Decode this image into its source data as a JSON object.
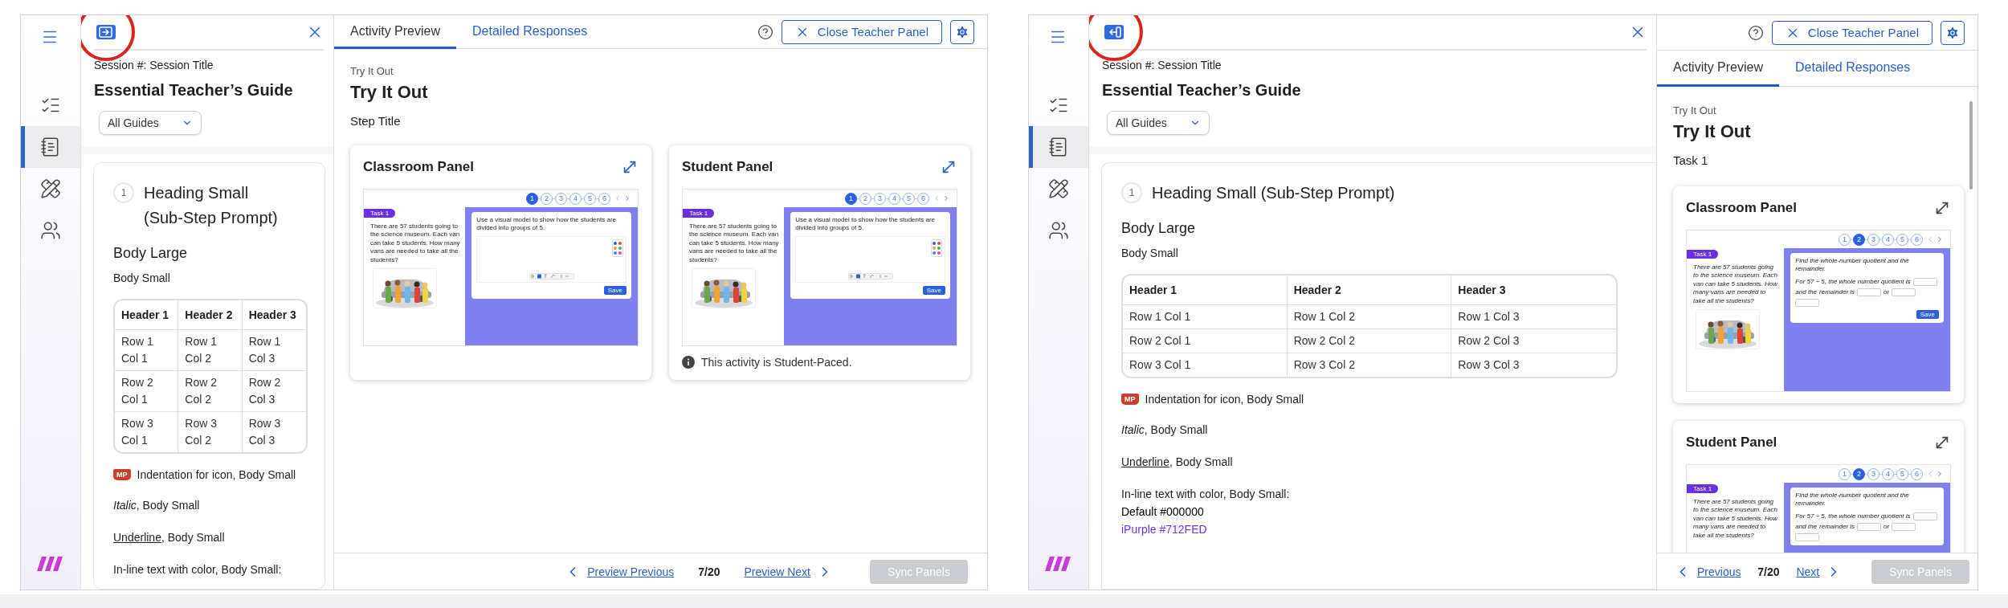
{
  "mockups": [
    {
      "kind": "narrow-guide",
      "rail": {
        "items": [
          {
            "kind": "list",
            "selected": false
          },
          {
            "kind": "notebook",
            "selected": true
          },
          {
            "kind": "tools",
            "selected": false
          },
          {
            "kind": "people",
            "selected": false
          }
        ]
      },
      "guide": {
        "toggle": {
          "kind": "expand",
          "highlighted": true
        },
        "session": "Session #: Session Title",
        "title": "Essential Teacher’s Guide",
        "filter": "All Guides",
        "step_number": "1",
        "heading": "Heading Small (Sub-Step Prompt)",
        "body_large": "Body Large",
        "body_small": "Body Small",
        "table": {
          "columns": [
            "Header 1",
            "Header 2",
            "Header 3"
          ],
          "rows": [
            [
              "Row 1 Col 1",
              "Row 1 Col 2",
              "Row 1 Col 3"
            ],
            [
              "Row 2 Col 1",
              "Row 2 Col 2",
              "Row 2 Col 3"
            ],
            [
              "Row 3 Col 1",
              "Row 3 Col 2",
              "Row 3 Col 3"
            ]
          ]
        },
        "icon_note": {
          "badge": "MP",
          "text": "Indentation for icon, Body Small"
        },
        "italic_note": "*Italic*, Body Small",
        "underline_note": {
          "underlined": "Underline",
          "text": ", Body Small"
        },
        "color_note": "In-line text with color, Body Small:"
      },
      "preview": {
        "tabs": [
          {
            "label": "Activity Preview",
            "selected": true
          },
          {
            "label": "Detailed Responses",
            "selected": false
          }
        ],
        "close_button": "Close Teacher Panel",
        "eyebrow": "Try It Out",
        "title": "Try It Out",
        "subtitle": "Step Title",
        "panels": [
          {
            "title": "Classroom Panel",
            "thumbnail": {
              "kind": "drawing",
              "steps": [
                {
                  "label": "1",
                  "selected": true
                },
                {
                  "label": "2",
                  "selected": false
                },
                {
                  "label": "3",
                  "selected": false
                },
                {
                  "label": "4",
                  "selected": false
                },
                {
                  "label": "5",
                  "selected": false
                },
                {
                  "label": "6",
                  "selected": false
                }
              ],
              "tag": "Task 1",
              "story": "There are 57 students going to the science museum. Each van can take 5 students. How many vans are needed to take all the students?",
              "prompt": "Use a visual model to show how the students are divided into groups of 5.",
              "save": "Save"
            }
          },
          {
            "title": "Student Panel",
            "thumbnail": {
              "kind": "drawing",
              "steps": [
                {
                  "label": "1",
                  "selected": true
                },
                {
                  "label": "2",
                  "selected": false
                },
                {
                  "label": "3",
                  "selected": false
                },
                {
                  "label": "4",
                  "selected": false
                },
                {
                  "label": "5",
                  "selected": false
                },
                {
                  "label": "6",
                  "selected": false
                }
              ],
              "tag": "Task 1",
              "story": "There are 57 students going to the science museum. Each van can take 5 students. How many vans are needed to take all the students?",
              "prompt": "Use a visual model to show how the students are divided into groups of 5.",
              "save": "Save"
            },
            "note": "This activity is Student-Paced."
          }
        ],
        "footer": {
          "previous": "Preview Previous",
          "page": "7/20",
          "next": "Preview Next",
          "sync": {
            "label": "Sync Panels",
            "disabled": true
          }
        }
      }
    },
    {
      "kind": "wide-guide",
      "rail": {
        "items": [
          {
            "kind": "list",
            "selected": false
          },
          {
            "kind": "notebook",
            "selected": true
          },
          {
            "kind": "tools",
            "selected": false
          },
          {
            "kind": "people",
            "selected": false
          }
        ]
      },
      "guide": {
        "toggle": {
          "kind": "collapse",
          "highlighted": true
        },
        "session": "Session #: Session Title",
        "title": "Essential Teacher’s Guide",
        "filter": "All Guides",
        "step_number": "1",
        "heading": "Heading Small (Sub-Step Prompt)",
        "body_large": "Body Large",
        "body_small": "Body Small",
        "table": {
          "columns": [
            "Header 1",
            "Header 2",
            "Header 3"
          ],
          "rows": [
            [
              "Row 1 Col 1",
              "Row 1 Col 2",
              "Row 1 Col 3"
            ],
            [
              "Row 2 Col 1",
              "Row 2 Col 2",
              "Row 2 Col 3"
            ],
            [
              "Row 3 Col 1",
              "Row 3 Col 2",
              "Row 3 Col 3"
            ]
          ]
        },
        "icon_note": {
          "badge": "MP",
          "text": "Indentation for icon, Body Small"
        },
        "italic_note": "*Italic*, Body Small",
        "underline_note": {
          "underlined": "Underline",
          "text": ", Body Small"
        },
        "color_note": "In-line text with color, Body Small:",
        "color_samples": [
          {
            "text": "Default #000000",
            "color": "#000000"
          },
          {
            "text": "iPurple #712FED",
            "color": "#712fed"
          }
        ]
      },
      "preview": {
        "tabs": [
          {
            "label": "Activity Preview",
            "selected": true
          },
          {
            "label": "Detailed Responses",
            "selected": false
          }
        ],
        "close_button": "Close Teacher Panel",
        "eyebrow": "Try It Out",
        "title": "Try It Out",
        "subtitle": "Task 1",
        "panels": [
          {
            "title": "Classroom Panel",
            "thumbnail": {
              "kind": "fill-in",
              "steps": [
                {
                  "label": "1",
                  "selected": false
                },
                {
                  "label": "2",
                  "selected": true
                },
                {
                  "label": "3",
                  "selected": false
                },
                {
                  "label": "4",
                  "selected": false
                },
                {
                  "label": "5",
                  "selected": false
                },
                {
                  "label": "6",
                  "selected": false
                }
              ],
              "tag": "Task 1",
              "story": "There are 57 students going to the science museum. Each van can take 5 students. How many vans are needed to take all the students?",
              "prompt": "Find the whole-number quotient and the remainder.",
              "sentence_start": "For 57 ÷ 5, the whole number quotient is",
              "sentence_mid": "and the",
              "sentence_next": "remainder is",
              "sentence_or": "or",
              "save": "Save"
            }
          },
          {
            "title": "Student Panel",
            "thumbnail": {
              "kind": "fill-in",
              "steps": [
                {
                  "label": "1",
                  "selected": false
                },
                {
                  "label": "2",
                  "selected": true
                },
                {
                  "label": "3",
                  "selected": false
                },
                {
                  "label": "4",
                  "selected": false
                },
                {
                  "label": "5",
                  "selected": false
                },
                {
                  "label": "6",
                  "selected": false
                }
              ],
              "tag": "Task 1",
              "story": "There are 57 students going to the science museum. Each van can take 5 students. How many vans are needed to take all the students?",
              "prompt": "Find the whole-number quotient and the remainder.",
              "sentence_start": "For 57 ÷ 5, the whole number quotient is",
              "sentence_mid": "and the",
              "sentence_next": "remainder is",
              "sentence_or": "or"
            }
          }
        ],
        "footer": {
          "previous": "Previous",
          "page": "7/20",
          "next": "Next",
          "sync": {
            "label": "Sync Panels",
            "disabled": true
          }
        }
      }
    }
  ]
}
